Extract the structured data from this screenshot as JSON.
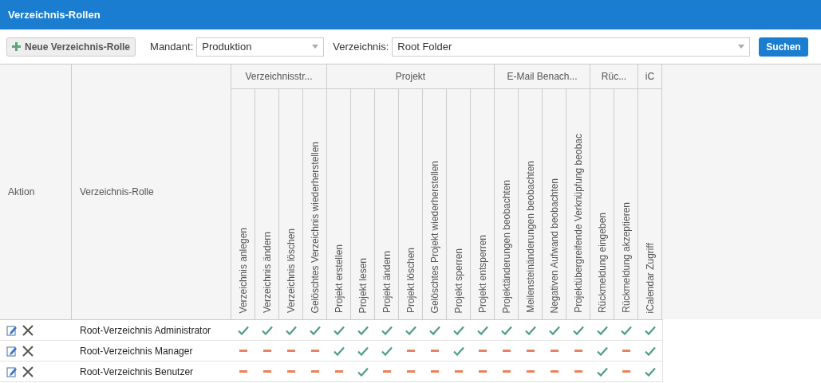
{
  "window": {
    "title": "Verzeichnis-Rollen"
  },
  "toolbar": {
    "new_button": "Neue Verzeichnis-Rolle",
    "mandant_label": "Mandant:",
    "mandant_value": "Produktion",
    "verzeichnis_label": "Verzeichnis:",
    "verzeichnis_value": "Root Folder",
    "search_button": "Suchen"
  },
  "table": {
    "action_column": "Aktion",
    "role_column": "Verzeichnis-Rolle",
    "groups": [
      {
        "label": "Verzeichnisstr...",
        "columns": [
          "Verzeichnis anlegen",
          "Verzeichnis ändern",
          "Verzeichnis löschen",
          "Gelöschtes Verzeichnis wiederherstellen"
        ]
      },
      {
        "label": "Projekt",
        "columns": [
          "Projekt erstellen",
          "Projekt lesen",
          "Projekt ändern",
          "Projekt löschen",
          "Gelöschtes Projekt wiederherstellen",
          "Projekt sperren",
          "Projekt entsperren"
        ]
      },
      {
        "label": "E-Mail Benach...",
        "columns": [
          "Projektänderungen beobachten",
          "Meilensteinänderungen beobachten",
          "Negativen Aufwand beobachten",
          "Projektübergreifende Verknüpfung beobac"
        ]
      },
      {
        "label": "Rüc...",
        "columns": [
          "Rückmeldung eingeben",
          "Rückmeldung akzeptieren"
        ]
      },
      {
        "label": "iC",
        "columns": [
          "iCalendar Zugriff"
        ]
      }
    ],
    "rows": [
      {
        "role": "Root-Verzeichnis Administrator",
        "permissions": [
          true,
          true,
          true,
          true,
          true,
          true,
          true,
          true,
          true,
          true,
          true,
          true,
          true,
          true,
          true,
          true,
          true,
          true
        ]
      },
      {
        "role": "Root-Verzeichnis Manager",
        "permissions": [
          false,
          false,
          false,
          false,
          true,
          true,
          true,
          false,
          false,
          true,
          false,
          false,
          false,
          false,
          false,
          true,
          false,
          true
        ]
      },
      {
        "role": "Root-Verzeichnis Benutzer",
        "permissions": [
          false,
          false,
          false,
          false,
          false,
          true,
          false,
          false,
          false,
          false,
          false,
          false,
          false,
          false,
          false,
          true,
          false,
          true
        ]
      }
    ]
  }
}
